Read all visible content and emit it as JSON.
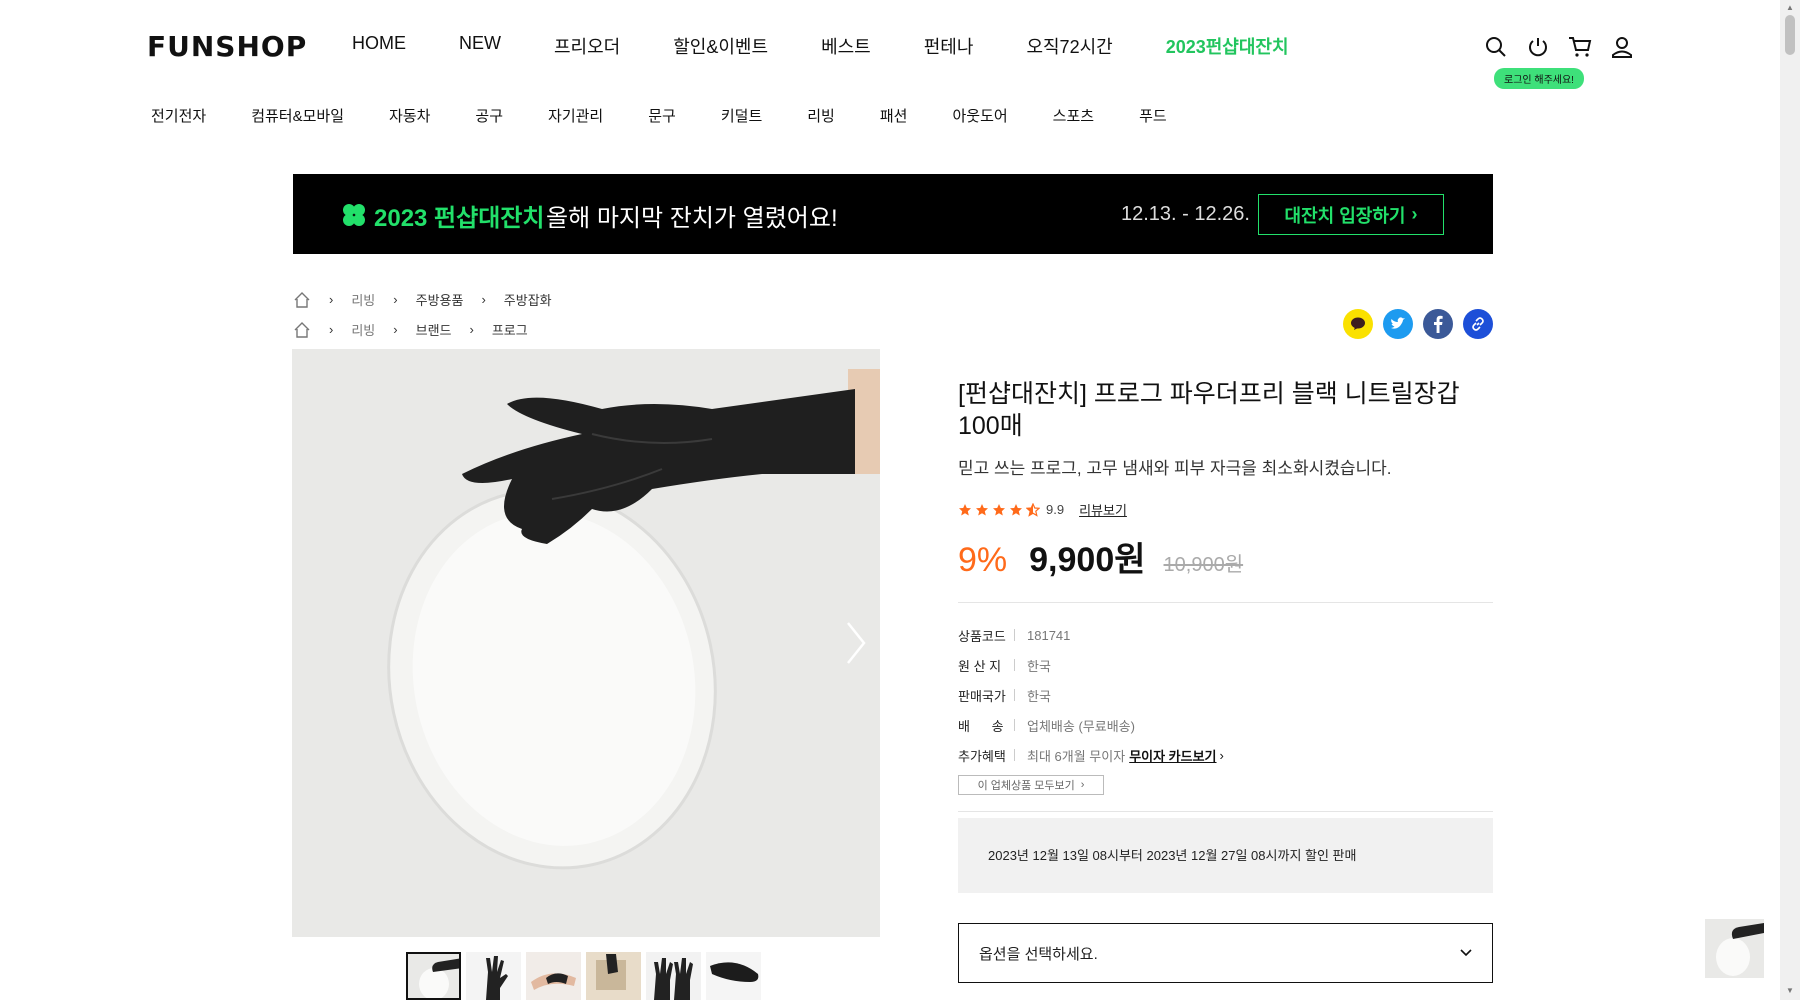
{
  "header": {
    "logo": "FUNSHOP",
    "nav": [
      {
        "label": "HOME",
        "highlight": false
      },
      {
        "label": "NEW",
        "highlight": false
      },
      {
        "label": "프리오더",
        "highlight": false
      },
      {
        "label": "할인&이벤트",
        "highlight": false
      },
      {
        "label": "베스트",
        "highlight": false
      },
      {
        "label": "펀테나",
        "highlight": false
      },
      {
        "label": "오직72시간",
        "highlight": false
      },
      {
        "label": "2023펀샵대잔치",
        "highlight": true
      }
    ],
    "icons": [
      "search-icon",
      "power-icon",
      "cart-icon",
      "user-icon"
    ],
    "login_badge": "로그인 해주세요!",
    "categories": [
      "전기전자",
      "컴퓨터&모바일",
      "자동차",
      "공구",
      "자기관리",
      "문구",
      "키덜트",
      "리빙",
      "패션",
      "아웃도어",
      "스포츠",
      "푸드"
    ]
  },
  "banner": {
    "title": "2023 펀샵대잔치",
    "subtitle": "올해 마지막 잔치가 열렸어요!",
    "date": "12.13. - 12.26.",
    "button": "대잔치 입장하기"
  },
  "breadcrumbs": [
    [
      "리빙",
      "주방용품",
      "주방잡화"
    ],
    [
      "리빙",
      "브랜드",
      "프로그"
    ]
  ],
  "product": {
    "title": "[펀샵대잔치] 프로그 파우더프리 블랙 니트릴장갑 100매",
    "description": "믿고 쓰는 프로그, 고무 냄새와 피부 자극을 최소화시켰습니다.",
    "rating": "9.9",
    "rating_stars": 4.5,
    "review_link": "리뷰보기",
    "discount_rate": "9%",
    "price": "9,900원",
    "original_price": "10,900원",
    "specs": [
      {
        "key": "상품코드",
        "value": "181741"
      },
      {
        "key": "원 산 지",
        "value": "한국"
      },
      {
        "key": "판매국가",
        "value": "한국"
      },
      {
        "key": "배      송",
        "value": "업체배송 (무료배송)"
      },
      {
        "key": "추가혜택",
        "value": "최대 6개월 무이자",
        "link": "무이자 카드보기"
      }
    ],
    "vendor_button": "이 업체상품 모두보기",
    "notice": "2023년 12월 13일 08시부터 2023년 12월 27일 08시까지 할인 판매",
    "option_placeholder": "옵션을 선택하세요."
  },
  "colors": {
    "accent_green": "#22e06a",
    "discount_orange": "#ff6a1a",
    "kakao": "#fae100",
    "twitter": "#1d9bf0",
    "facebook": "#3b5998",
    "link": "#1d4fd8"
  }
}
